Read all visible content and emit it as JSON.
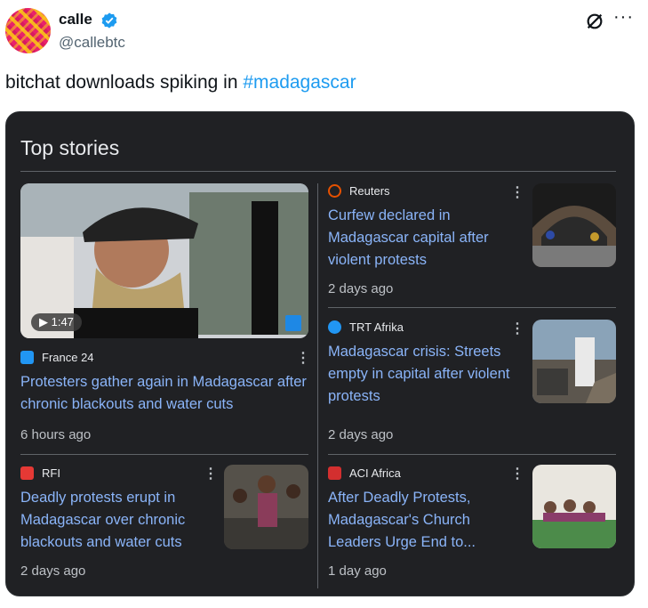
{
  "author": {
    "name": "calle",
    "handle": "@callebtc"
  },
  "tweet": {
    "text": "bitchat downloads spiking in ",
    "hashtag": "#madagascar"
  },
  "card": {
    "title": "Top stories",
    "stories": [
      {
        "source": "France 24",
        "headline": "Protesters gather again in Madagascar after chronic blackouts and water cuts",
        "age": "6 hours ago",
        "video_duration": "▶ 1:47"
      },
      {
        "source": "Reuters",
        "headline": "Curfew declared in Madagascar capital after violent protests",
        "age": "2 days ago"
      },
      {
        "source": "TRT Afrika",
        "headline": "Madagascar crisis: Streets empty in capital after violent protests",
        "age": "2 days ago"
      },
      {
        "source": "RFI",
        "headline": "Deadly protests erupt in Madagascar over chronic blackouts and water cuts",
        "age": "2 days ago"
      },
      {
        "source": "ACI Africa",
        "headline": "After Deadly Protests, Madagascar's Church Leaders Urge End to...",
        "age": "1 day ago"
      }
    ]
  },
  "colors": {
    "card_bg": "#202124",
    "link": "#8ab4f8",
    "hashtag": "#1d9bf0",
    "verified": "#1d9bf0"
  },
  "icons": [
    "verified-badge-icon",
    "grok-icon",
    "more-icon",
    "kebab-icon",
    "play-icon"
  ]
}
